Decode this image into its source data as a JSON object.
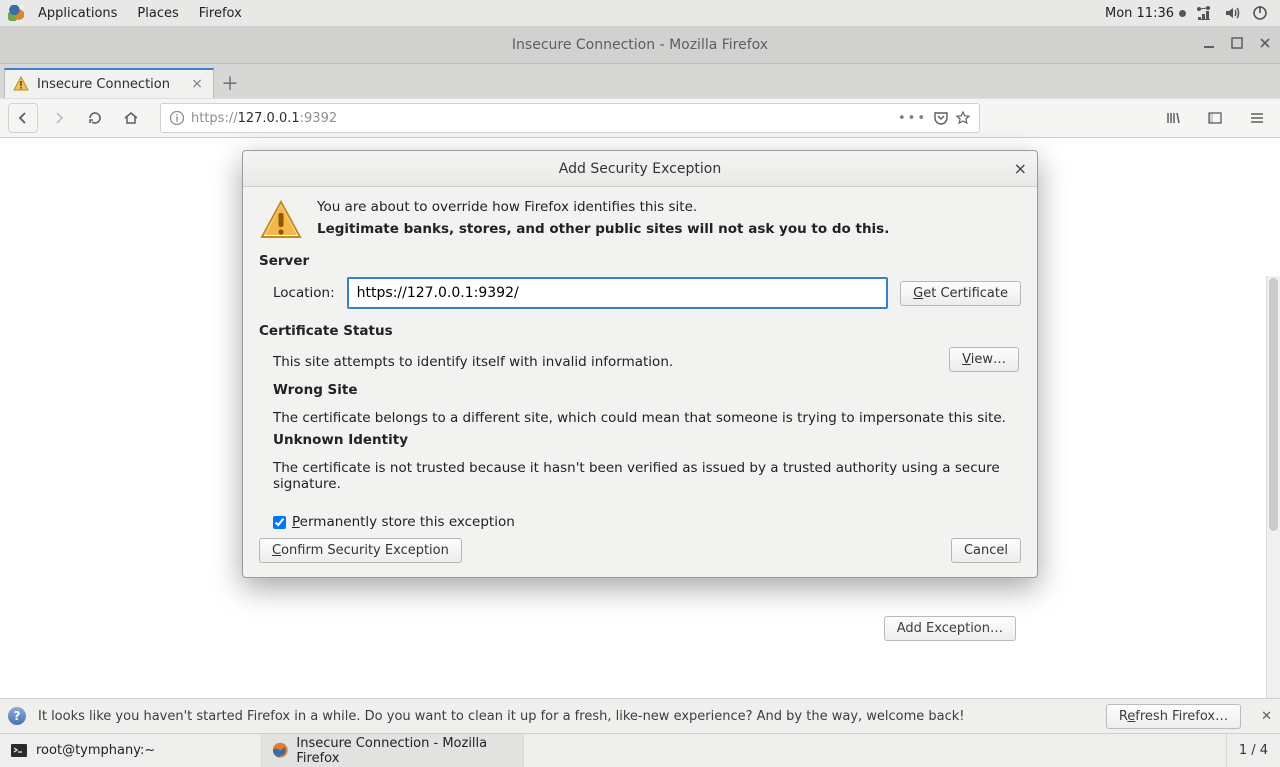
{
  "gnome": {
    "apps": "Applications",
    "places": "Places",
    "firefox": "Firefox",
    "clock": "Mon 11:36"
  },
  "window": {
    "title": "Insecure Connection - Mozilla Firefox"
  },
  "tab": {
    "title": "Insecure Connection"
  },
  "url": {
    "scheme": "https://",
    "host": "127.0.0.1",
    "port": ":9392"
  },
  "page": {
    "add_exception": "Add Exception…"
  },
  "dialog": {
    "title": "Add Security Exception",
    "warn_line1": "You are about to override how Firefox identifies this site.",
    "warn_line2": "Legitimate banks, stores, and other public sites will not ask you to do this.",
    "server_h": "Server",
    "location_label": "Location:",
    "location_value": "https://127.0.0.1:9392/",
    "get_cert": "Get Certificate",
    "cert_status_h": "Certificate Status",
    "cert_status_text": "This site attempts to identify itself with invalid information.",
    "view_btn": "View…",
    "wrong_site_h": "Wrong Site",
    "wrong_site_text": "The certificate belongs to a different site, which could mean that someone is trying to impersonate this site.",
    "unknown_h": "Unknown Identity",
    "unknown_text": "The certificate is not trusted because it hasn't been verified as issued by a trusted authority using a secure signature.",
    "perm_store": "Permanently store this exception",
    "confirm": "Confirm Security Exception",
    "cancel": "Cancel"
  },
  "infobar": {
    "text": "It looks like you haven't started Firefox in a while. Do you want to clean it up for a fresh, like-new experience? And by the way, welcome back!",
    "refresh": "Refresh Firefox…"
  },
  "taskbar": {
    "term": "root@tymphany:~",
    "firefox": "Insecure Connection - Mozilla Firefox",
    "ws": "1 / 4"
  }
}
